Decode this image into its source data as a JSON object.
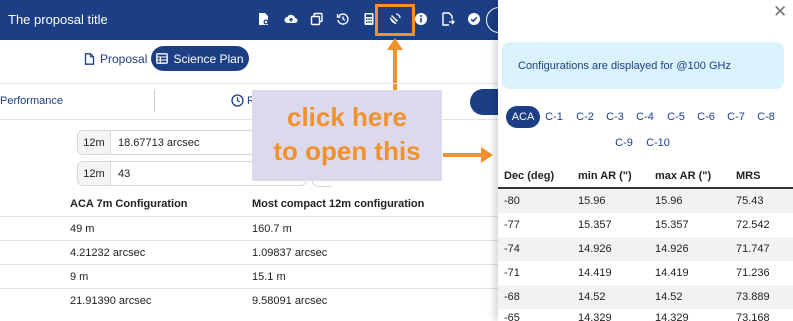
{
  "header": {
    "title": "The proposal title",
    "icons": [
      "file-settings-icon",
      "cloud-upload-icon",
      "copy-icon",
      "history-icon",
      "calculator-icon",
      "satellite-dish-icon",
      "info-icon",
      "file-export-icon",
      "check-circle-icon"
    ]
  },
  "tabs": [
    {
      "label": "Proposal",
      "icon": "document-icon",
      "active": false
    },
    {
      "label": "Science Plan",
      "icon": "table-icon",
      "active": true
    }
  ],
  "subnav": {
    "performance_label": "Performance",
    "second_label": "R"
  },
  "inputs": [
    {
      "unit": "12m",
      "value": "18.67713 arcsec"
    },
    {
      "unit": "12m",
      "value": "43"
    }
  ],
  "left_table": {
    "headers": [
      "ACA 7m Configuration",
      "Most compact 12m configuration"
    ],
    "rows": [
      [
        "49 m",
        "160.7 m"
      ],
      [
        "4.21232 arcsec",
        "1.09837 arcsec"
      ],
      [
        "9 m",
        "15.1 m"
      ],
      [
        "21.91390 arcsec",
        "9.58091 arcsec"
      ]
    ]
  },
  "annotation": {
    "line1": "click here",
    "line2": "to open this",
    "color": "#f0912c"
  },
  "panel": {
    "close_icon": "close-icon",
    "info_text": "Configurations are displayed for @100 GHz",
    "config_tabs": [
      "ACA",
      "C-1",
      "C-2",
      "C-3",
      "C-4",
      "C-5",
      "C-6",
      "C-7",
      "C-8",
      "C-9",
      "C-10"
    ],
    "active_tab": "ACA",
    "table": {
      "headers": [
        "Dec (deg)",
        "min AR (\")",
        "max AR (\")",
        "MRS"
      ],
      "rows": [
        [
          "-80",
          "15.96",
          "15.96",
          "75.43"
        ],
        [
          "-77",
          "15.357",
          "15.357",
          "72.542"
        ],
        [
          "-74",
          "14.926",
          "14.926",
          "71.747"
        ],
        [
          "-71",
          "14.419",
          "14.419",
          "71.236"
        ],
        [
          "-68",
          "14.52",
          "14.52",
          "73.889"
        ],
        [
          "-65",
          "14.329",
          "14.329",
          "73.168"
        ]
      ]
    }
  },
  "colors": {
    "brand": "#1c3e85",
    "info_bg": "#d9f2fb",
    "annotation_bg": "#ddd9ec"
  }
}
